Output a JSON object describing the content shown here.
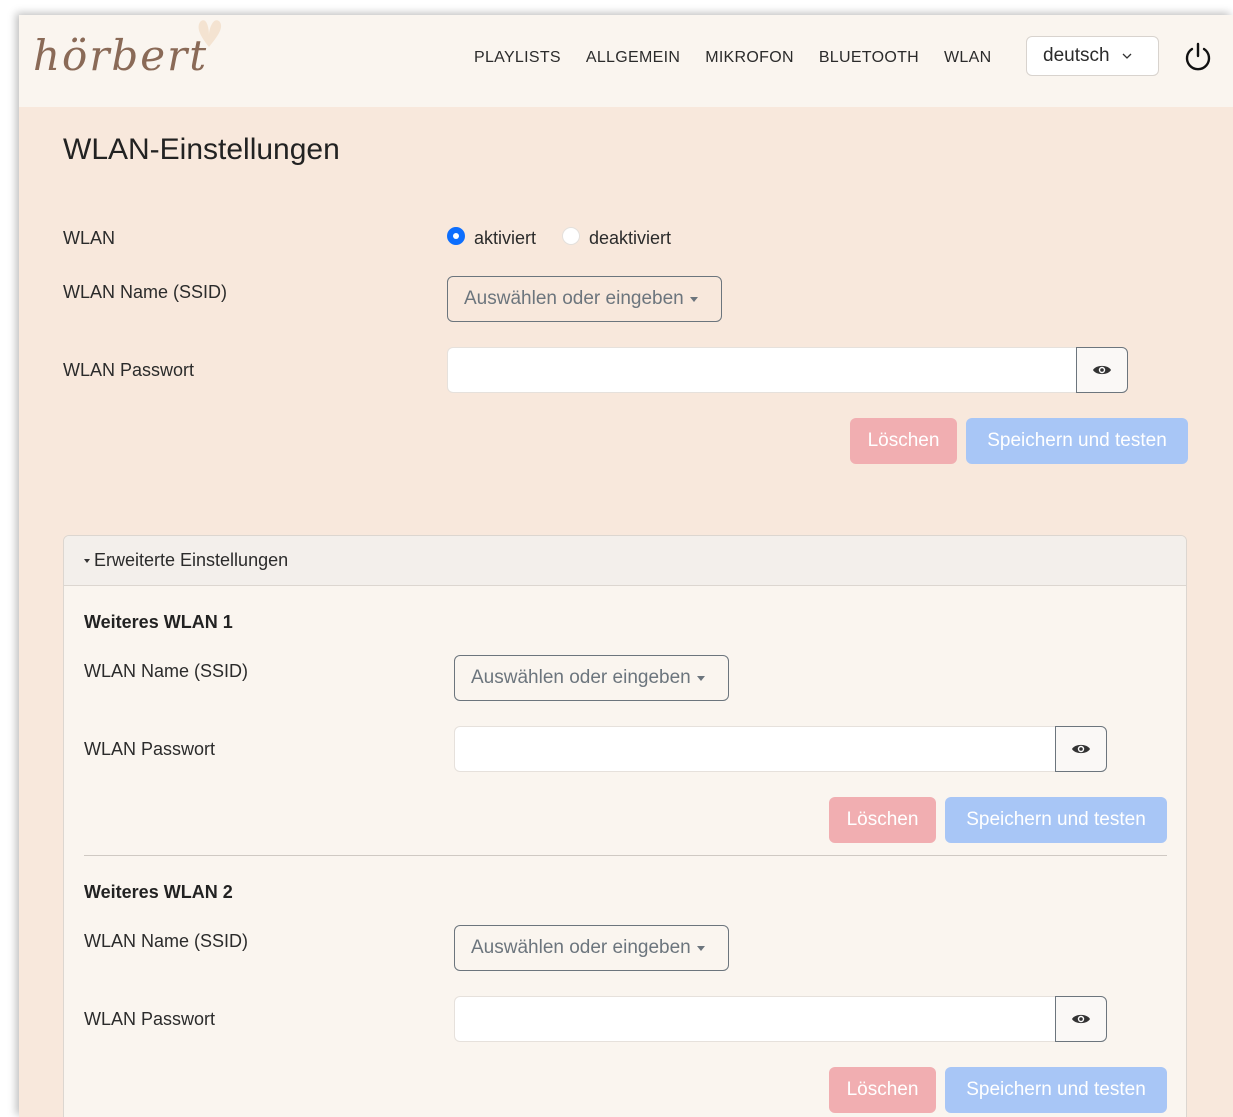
{
  "navbar": {
    "logo": "hörbert",
    "links": [
      "PLAYLISTS",
      "ALLGEMEIN",
      "MIKROFON",
      "BLUETOOTH",
      "WLAN"
    ],
    "language": "deutsch"
  },
  "page": {
    "title": "WLAN-Einstellungen",
    "wlan_label": "WLAN",
    "radio_on": "aktiviert",
    "radio_off": "deaktiviert",
    "ssid_label": "WLAN Name (SSID)",
    "ssid_placeholder": "Auswählen oder eingeben",
    "password_label": "WLAN Passwort",
    "delete_label": "Löschen",
    "save_label": "Speichern und testen"
  },
  "advanced": {
    "header": "Erweiterte Einstellungen",
    "networks": [
      {
        "title": "Weiteres WLAN 1",
        "ssid_label": "WLAN Name (SSID)",
        "ssid_placeholder": "Auswählen oder eingeben",
        "password_label": "WLAN Passwort",
        "delete_label": "Löschen",
        "save_label": "Speichern und testen"
      },
      {
        "title": "Weiteres WLAN 2",
        "ssid_label": "WLAN Name (SSID)",
        "ssid_placeholder": "Auswählen oder eingeben",
        "password_label": "WLAN Passwort",
        "delete_label": "Löschen",
        "save_label": "Speichern und testen"
      }
    ]
  },
  "colors": {
    "background": "#f8e8dc",
    "navbar": "#faf5ef",
    "accent": "#0d6efd",
    "delete": "#f1aeb1",
    "save": "#a8c6f6"
  },
  "icons": [
    "butterfly-icon",
    "chevron-down-icon",
    "power-icon",
    "eye-icon"
  ]
}
